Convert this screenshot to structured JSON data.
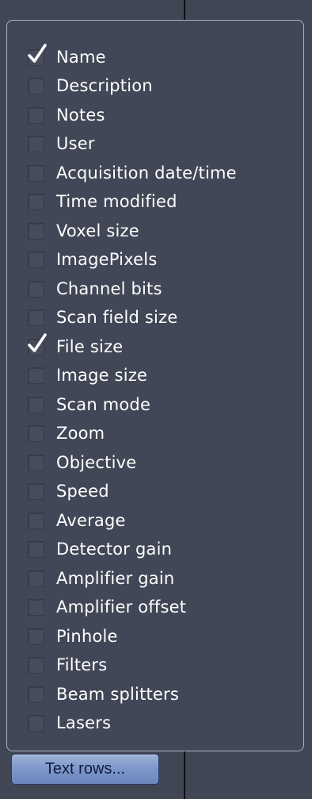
{
  "columns": [
    {
      "label": "Name",
      "checked": true
    },
    {
      "label": "Description",
      "checked": false
    },
    {
      "label": "Notes",
      "checked": false
    },
    {
      "label": "User",
      "checked": false
    },
    {
      "label": "Acquisition date/time",
      "checked": false
    },
    {
      "label": "Time modified",
      "checked": false
    },
    {
      "label": "Voxel size",
      "checked": false
    },
    {
      "label": "ImagePixels",
      "checked": false
    },
    {
      "label": "Channel bits",
      "checked": false
    },
    {
      "label": "Scan field size",
      "checked": false
    },
    {
      "label": "File size",
      "checked": true
    },
    {
      "label": "Image size",
      "checked": false
    },
    {
      "label": "Scan mode",
      "checked": false
    },
    {
      "label": "Zoom",
      "checked": false
    },
    {
      "label": "Objective",
      "checked": false
    },
    {
      "label": "Speed",
      "checked": false
    },
    {
      "label": "Average",
      "checked": false
    },
    {
      "label": "Detector gain",
      "checked": false
    },
    {
      "label": "Amplifier gain",
      "checked": false
    },
    {
      "label": "Amplifier offset",
      "checked": false
    },
    {
      "label": "Pinhole",
      "checked": false
    },
    {
      "label": "Filters",
      "checked": false
    },
    {
      "label": "Beam splitters",
      "checked": false
    },
    {
      "label": "Lasers",
      "checked": false
    }
  ],
  "button": {
    "label": "Text rows..."
  },
  "colors": {
    "background": "#404654",
    "panel_border": "#aeb3bc",
    "text": "#ffffff",
    "button": "#7d96c9"
  }
}
